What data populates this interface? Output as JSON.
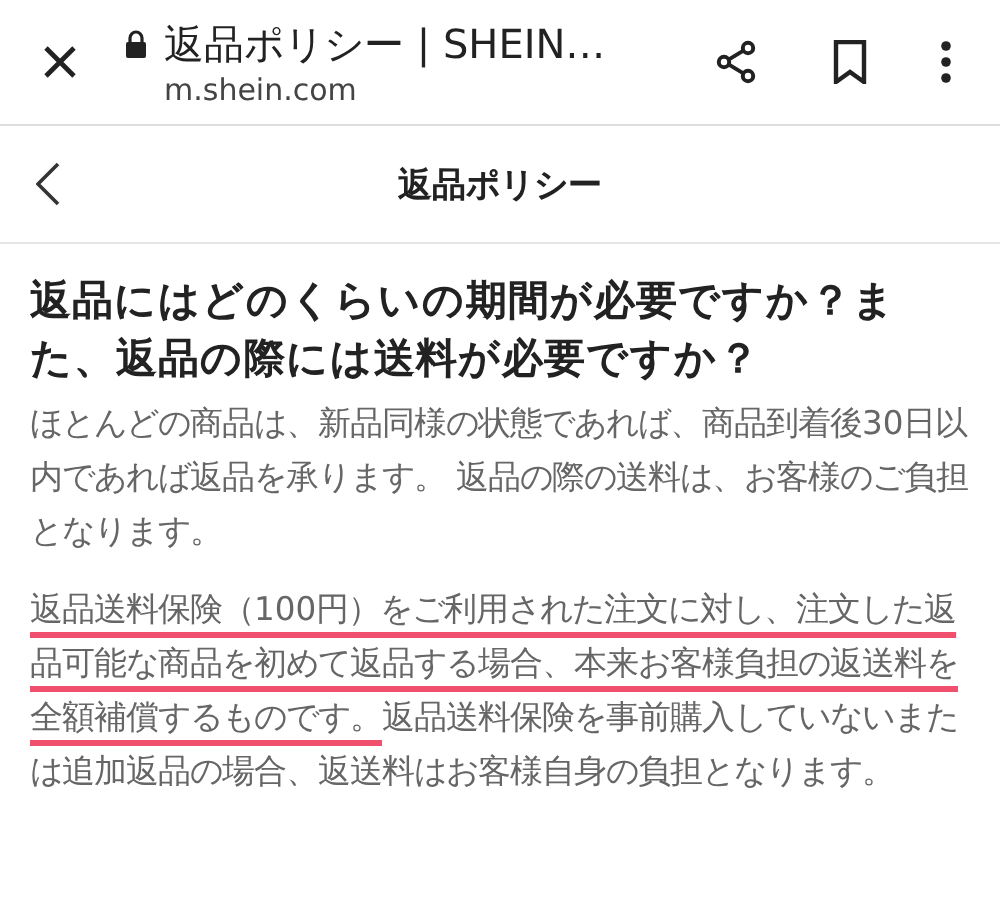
{
  "browser_bar": {
    "page_title": "返品ポリシー | SHEIN…",
    "url": "m.shein.com"
  },
  "header": {
    "title": "返品ポリシー"
  },
  "article": {
    "heading": "返品にはどのくらいの期間が必要ですか？また、返品の際には送料が必要ですか？",
    "paragraphs": [
      {
        "segments": [
          {
            "text": "ほとんどの商品は、新品同様の状態であれば、商品到着後30日以内であれば返品を承ります。 返品の際の送料は、お客様のご負担となります。",
            "underlined": false
          }
        ]
      },
      {
        "segments": [
          {
            "text": "返品送料保険（100円）をご利用された注文に対し、注文した返品可能な商品を初めて返品する場合、本来お客様負担の返送料を全額補償するものです。",
            "underlined": true
          },
          {
            "text": "返品送料保険を事前購入していないまたは追加返品の場合、返送料はお客様自身の負担となります。",
            "underlined": false
          }
        ]
      }
    ]
  }
}
